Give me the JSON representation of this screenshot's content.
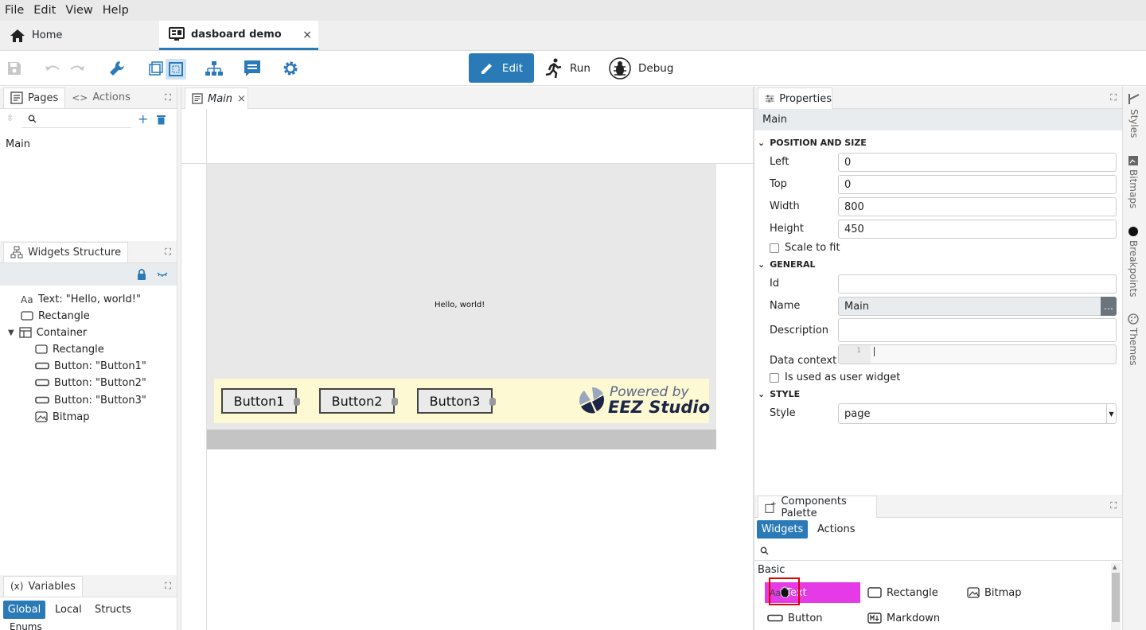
{
  "menu": [
    "File",
    "Edit",
    "View",
    "Help"
  ],
  "tabs": {
    "home": "Home",
    "project": "dasboard demo",
    "close": "×"
  },
  "toolbar": {
    "edit": "Edit",
    "run": "Run",
    "debug": "Debug",
    "accent": "#2a7ab8"
  },
  "pages_panel": {
    "tab_pages": "Pages",
    "tab_actions": "Actions",
    "items": [
      "Main"
    ]
  },
  "widgets_panel": {
    "title": "Widgets Structure",
    "items": [
      {
        "label": "Text: \"Hello, world!\"",
        "icon": "text-icon"
      },
      {
        "label": "Rectangle",
        "icon": "rectangle-icon"
      },
      {
        "label": "Container",
        "icon": "container-icon"
      },
      {
        "label": "Rectangle",
        "icon": "rectangle-icon"
      },
      {
        "label": "Button: \"Button1\"",
        "icon": "button-icon"
      },
      {
        "label": "Button: \"Button2\"",
        "icon": "button-icon"
      },
      {
        "label": "Button: \"Button3\"",
        "icon": "button-icon"
      },
      {
        "label": "Bitmap",
        "icon": "bitmap-icon"
      }
    ]
  },
  "variables_panel": {
    "title": "Variables",
    "title_prefix": "(x)",
    "tabs": [
      "Global",
      "Local",
      "Structs"
    ],
    "enums": "Enums"
  },
  "editor": {
    "tab": "Main",
    "hello": "Hello, world!",
    "buttons": [
      "Button1",
      "Button2",
      "Button3"
    ],
    "powered_by": "Powered by",
    "studio": "EEZ Studio"
  },
  "properties": {
    "title": "Properties",
    "object": "Main",
    "sections": {
      "position": "POSITION AND SIZE",
      "general": "GENERAL",
      "style": "STYLE"
    },
    "left_label": "Left",
    "left": "0",
    "top_label": "Top",
    "top": "0",
    "width_label": "Width",
    "width": "800",
    "height_label": "Height",
    "height": "450",
    "scale_to_fit": "Scale to fit",
    "id_label": "Id",
    "id": "",
    "name_label": "Name",
    "name": "Main",
    "name_more": "…",
    "description_label": "Description",
    "description": "",
    "data_context_label": "Data context",
    "data_context_line": "1",
    "user_widget": "Is used as user widget",
    "style_label": "Style",
    "style": "page"
  },
  "side_tabs": [
    "Styles",
    "Bitmaps",
    "Breakpoints",
    "Themes"
  ],
  "palette": {
    "title": "Components Palette",
    "tab_widgets": "Widgets",
    "tab_actions": "Actions",
    "category": "Basic",
    "items": [
      "Text",
      "Rectangle",
      "Bitmap",
      "Button",
      "Markdown"
    ],
    "highlight_color": "#e53be6"
  }
}
